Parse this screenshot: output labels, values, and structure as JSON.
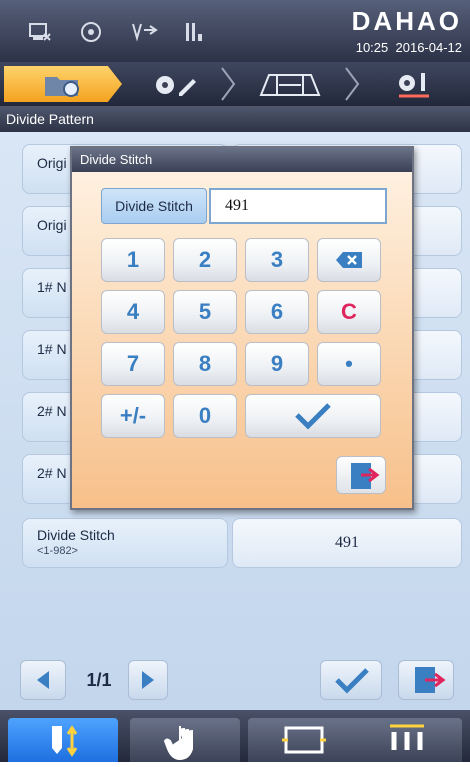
{
  "statusbar": {
    "brand": "DAHAO",
    "time": "10:25",
    "date": "2016-04-12",
    "icons": [
      "pattern-icon",
      "disk-icon",
      "thread-icon",
      "needle-icon"
    ]
  },
  "tabs": [
    {
      "name": "folder-flower-tab",
      "active": true
    },
    {
      "name": "flower-edit-tab",
      "active": false
    },
    {
      "name": "frame-measure-tab",
      "active": false
    },
    {
      "name": "flower-needle-tab",
      "active": false
    }
  ],
  "section_title": "Divide Pattern",
  "rows": [
    {
      "label": "Origi",
      "value": ""
    },
    {
      "label": "Origi",
      "value": ""
    },
    {
      "label": "1# N",
      "value": ""
    },
    {
      "label": "1# N",
      "value": ""
    },
    {
      "label": "2# N",
      "value": ""
    },
    {
      "label": "2# N",
      "value": ""
    }
  ],
  "divide_row": {
    "label": "Divide Stitch",
    "range": "<1-982>",
    "value": "491"
  },
  "dialog": {
    "title": "Divide Stitch",
    "field_label": "Divide Stitch",
    "field_value": "491",
    "keys": [
      "1",
      "2",
      "3",
      "4",
      "5",
      "6",
      "C",
      "7",
      "8",
      "9",
      "•",
      "+/-",
      "0"
    ]
  },
  "pager": {
    "current": "1/1"
  },
  "footer": [
    "needle-updown-icon",
    "hand-icon",
    "frame-icon",
    "three-needles-icon"
  ],
  "colors": {
    "accent_tab": "#f3a21f",
    "key_text": "#3a7fc2",
    "clear_key": "#e0245e"
  }
}
